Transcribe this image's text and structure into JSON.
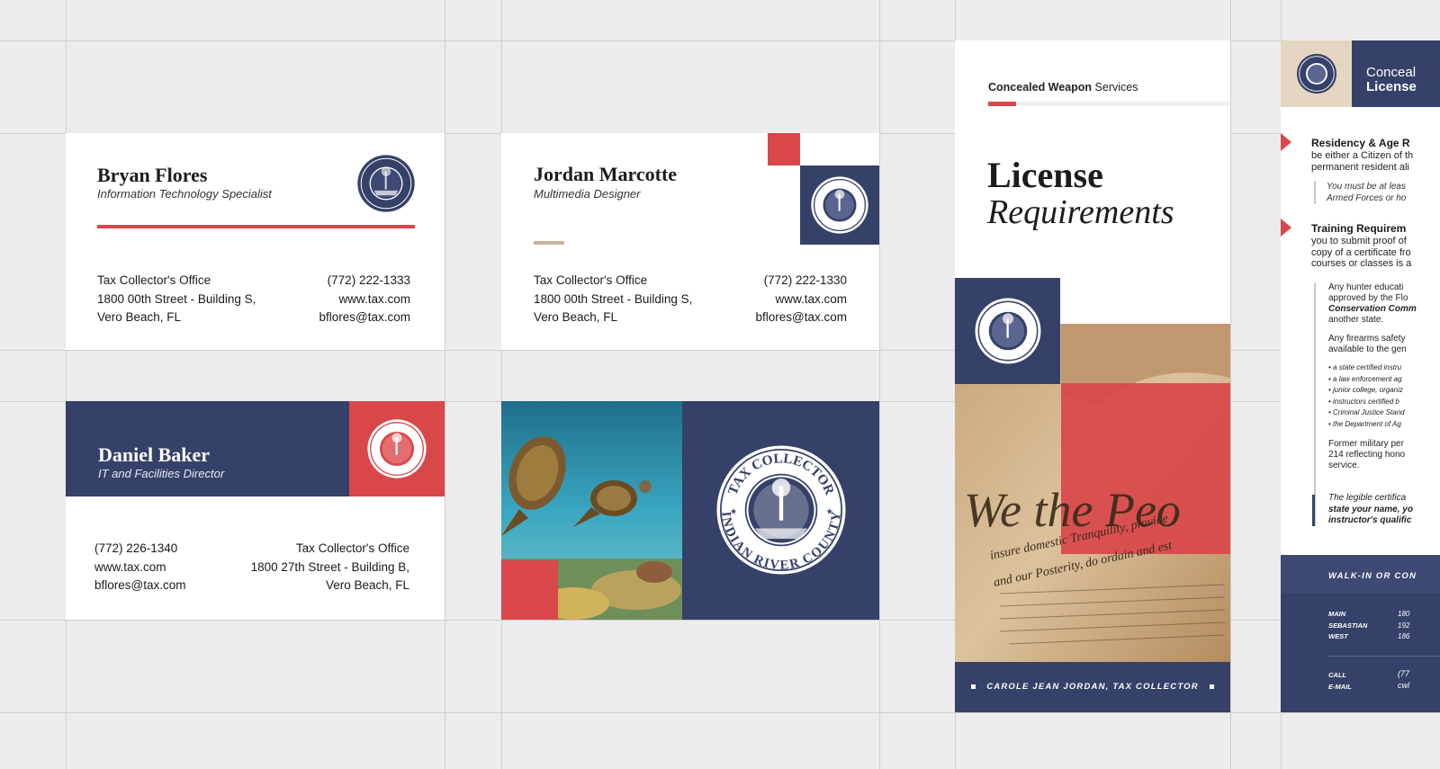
{
  "colors": {
    "navy": "#354168",
    "red": "#d9474a",
    "tan": "#c9b59a",
    "background": "#ececec"
  },
  "seal": {
    "top": "TAX COLLECTOR",
    "bottom": "INDIAN RIVER COUNTY"
  },
  "cards": [
    {
      "name": "Bryan Flores",
      "title": "Information Technology Specialist",
      "office": "Tax Collector's Office",
      "address1": "1800 00th Street - Building S,",
      "address2": "Vero Beach, FL",
      "phone": "(772) 222-1333",
      "web": "www.tax.com",
      "email": "bflores@tax.com"
    },
    {
      "name": "Jordan Marcotte",
      "title": "Multimedia Designer",
      "office": "Tax Collector's Office",
      "address1": "1800 00th Street - Building S,",
      "address2": "Vero Beach, FL",
      "phone": "(772) 222-1330",
      "web": "www.tax.com",
      "email": "bflores@tax.com"
    },
    {
      "name": "Daniel Baker",
      "title": "IT and Facilities Director",
      "office": "Tax Collector's Office",
      "address1": "1800 27th Street - Building B,",
      "address2": "Vero Beach, FL",
      "phone": "(772) 226-1340",
      "web": "www.tax.com",
      "email": "bflores@tax.com"
    }
  ],
  "brochure": {
    "header_bold": "Concealed Weapon",
    "header_rest": " Services",
    "title_line1": "License",
    "title_line2": "Requirements",
    "footer": "CAROLE JEAN JORDAN, TAX COLLECTOR",
    "document_text": [
      "We the Peo",
      "insure domestic Tranquility, provide",
      "and our Posterity, do ordain and est"
    ]
  },
  "brochure2": {
    "header_line1": "Conceal",
    "header_line2": "License",
    "sec1_title": "Residency & Age R",
    "sec1_line1": "be either a Citizen of th",
    "sec1_line2": "permanent resident ali",
    "sec1_quote1": "You must be at leas",
    "sec1_quote2": "Armed Forces or ho",
    "sec2_title": "Training Requirem",
    "sec2_line1": "you to submit proof of",
    "sec2_line2": "copy of a certificate fro",
    "sec2_line3": "courses or classes is a",
    "list_a1": "Any hunter educati",
    "list_a2": "approved by the Flo",
    "list_a3": "Conservation Comm",
    "list_a4": "another state.",
    "list_b1": "Any firearms safety",
    "list_b2": "available to the gen",
    "bullets": [
      "a state certified instru",
      "a law enforcement ag",
      "junior college, organiz",
      "instructors certified b",
      "Criminal Justice Stand",
      "the Department of Ag"
    ],
    "list_c1": "Former military per",
    "list_c2": "214 reflecting hono",
    "list_c3": "service.",
    "note1": "The legible certifica",
    "note2": "state your name, yo",
    "note3": "instructor's qualific",
    "walkin": "WALK-IN OR CON",
    "loc1": "MAIN",
    "loc1v": "180",
    "loc2": "SEBASTIAN",
    "loc2v": "192",
    "loc3": "WEST",
    "loc3v": "186",
    "call": "CALL",
    "callv": "(77",
    "email": "E-MAIL",
    "emailv": "cwl"
  }
}
